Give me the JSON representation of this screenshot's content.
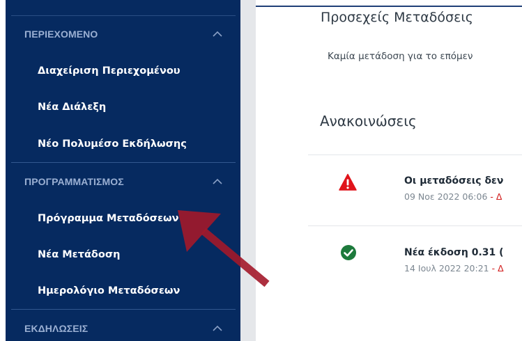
{
  "sidebar": {
    "sections": [
      {
        "title": "ΠΕΡΙΕΧΟΜΕΝΟ",
        "items": [
          "Διαχείριση Περιεχομένου",
          "Νέα Διάλεξη",
          "Νέο Πολυμέσο Εκδήλωσης"
        ]
      },
      {
        "title": "ΠΡΟΓΡΑΜΜΑΤΙΣΜΟΣ",
        "items": [
          "Πρόγραμμα Μεταδόσεων",
          "Νέα Μετάδοση",
          "Ημερολόγιο Μεταδόσεων"
        ]
      },
      {
        "title": "ΕΚΔΗΛΩΣΕΙΣ",
        "items": []
      }
    ]
  },
  "main": {
    "upcoming_title": "Προσεχείς Μεταδόσεις",
    "upcoming_empty": "Καμία μετάδοση για το επόμεν",
    "announcements_title": "Ανακοινώσεις",
    "announcements": [
      {
        "icon": "warning-icon",
        "title": "Οι μεταδόσεις δεν",
        "date": "09 Νοε 2022 06:06",
        "sep": " - Δ"
      },
      {
        "icon": "check-circle-icon",
        "title": "Νέα έκδοση 0.31 ( ",
        "date": "14 Ιουλ 2022 20:21",
        "sep": " - Δ"
      }
    ]
  },
  "colors": {
    "sidebar_bg": "#062a60",
    "section_title": "#9bb0d3",
    "arrow": "#a3182a",
    "warning": "#e0141b",
    "success": "#1d7a3c"
  }
}
